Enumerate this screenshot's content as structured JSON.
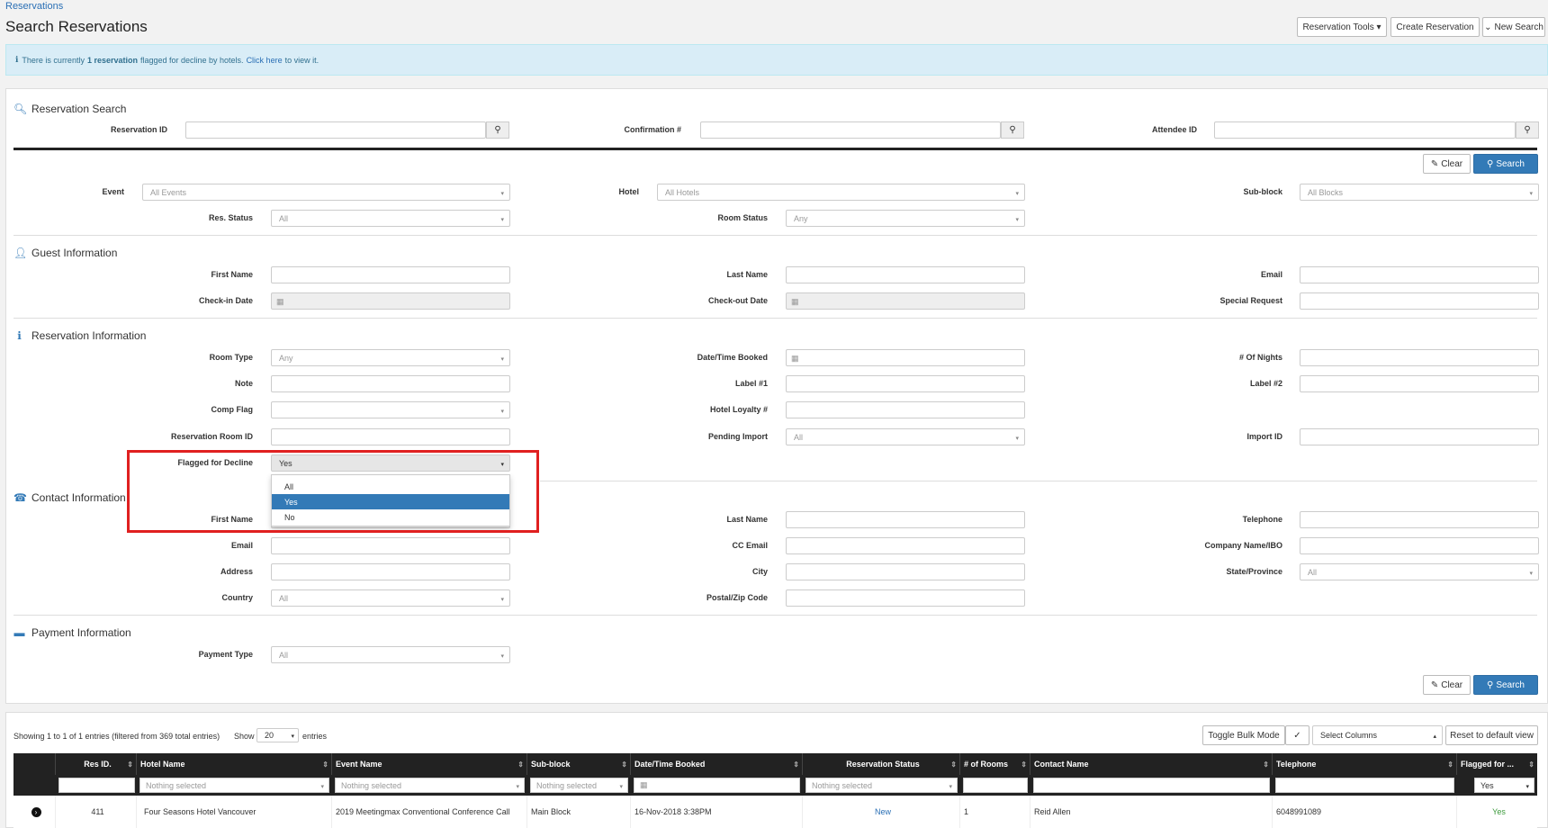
{
  "header": {
    "breadcrumb": "Reservations",
    "title": "Search Reservations",
    "tools_button": "Reservation Tools ▾",
    "create_button": "Create Reservation",
    "new_search_button": "New Search"
  },
  "alert": {
    "prefix": "There is currently",
    "count": "1 reservation",
    "middle": "flagged for decline by hotels.",
    "link": "Click here",
    "suffix": "to view it."
  },
  "search": {
    "section_title": "Reservation Search",
    "reservation_id_label": "Reservation ID",
    "confirmation_label": "Confirmation #",
    "attendee_label": "Attendee ID",
    "clear_label": "Clear",
    "search_label": "Search",
    "event_label": "Event",
    "event_value": "All Events",
    "hotel_label": "Hotel",
    "hotel_value": "All Hotels",
    "subblock_label": "Sub-block",
    "subblock_value": "All Blocks",
    "res_status_label": "Res. Status",
    "res_status_value": "All",
    "room_status_label": "Room Status",
    "room_status_value": "Any"
  },
  "guest": {
    "section_title": "Guest Information",
    "first_name": "First Name",
    "last_name": "Last Name",
    "email": "Email",
    "checkin": "Check-in Date",
    "checkout": "Check-out Date",
    "special": "Special Request"
  },
  "resinfo": {
    "section_title": "Reservation Information",
    "room_type": "Room Type",
    "room_type_value": "Any",
    "date_booked": "Date/Time Booked",
    "nights": "# Of Nights",
    "note": "Note",
    "label1": "Label #1",
    "label2": "Label #2",
    "comp_flag": "Comp Flag",
    "loyalty": "Hotel Loyalty #",
    "room_id": "Reservation Room ID",
    "pending_import": "Pending Import",
    "pending_import_value": "All",
    "import_id": "Import ID",
    "flagged": "Flagged for Decline",
    "flagged_value": "Yes",
    "flagged_options": [
      "All",
      "Yes",
      "No"
    ]
  },
  "contact": {
    "section_title": "Contact Information",
    "first_name": "First Name",
    "last_name": "Last Name",
    "telephone": "Telephone",
    "email": "Email",
    "cc_email": "CC Email",
    "company": "Company Name/IBO",
    "address": "Address",
    "city": "City",
    "state": "State/Province",
    "state_value": "All",
    "country": "Country",
    "country_value": "All",
    "postal": "Postal/Zip Code"
  },
  "payment": {
    "section_title": "Payment Information",
    "type": "Payment Type",
    "type_value": "All",
    "clear_label": "Clear",
    "search_label": "Search"
  },
  "results": {
    "showing": "Showing 1 to 1 of 1 entries (filtered from 369 total entries)",
    "show_label": "Show",
    "show_value": "20",
    "entries_label": "entries",
    "toggle_bulk": "Toggle Bulk Mode",
    "select_columns": "Select Columns",
    "reset_view": "Reset to default view",
    "columns": [
      "Res ID.",
      "Hotel Name",
      "Event Name",
      "Sub-block",
      "Date/Time Booked",
      "Reservation Status",
      "# of Rooms",
      "Contact Name",
      "Telephone",
      "Flagged for ..."
    ],
    "filter_placeholder": "Nothing selected",
    "flag_filter_value": "Yes",
    "row": {
      "res_id": "411",
      "hotel": "Four Seasons Hotel Vancouver",
      "event": "2019 Meetingmax Conventional Conference Call",
      "subblock": "Main Block",
      "date": "16-Nov-2018 3:38PM",
      "status": "New",
      "rooms": "1",
      "contact": "Reid Allen",
      "telephone": "6048991089",
      "flagged": "Yes"
    }
  }
}
